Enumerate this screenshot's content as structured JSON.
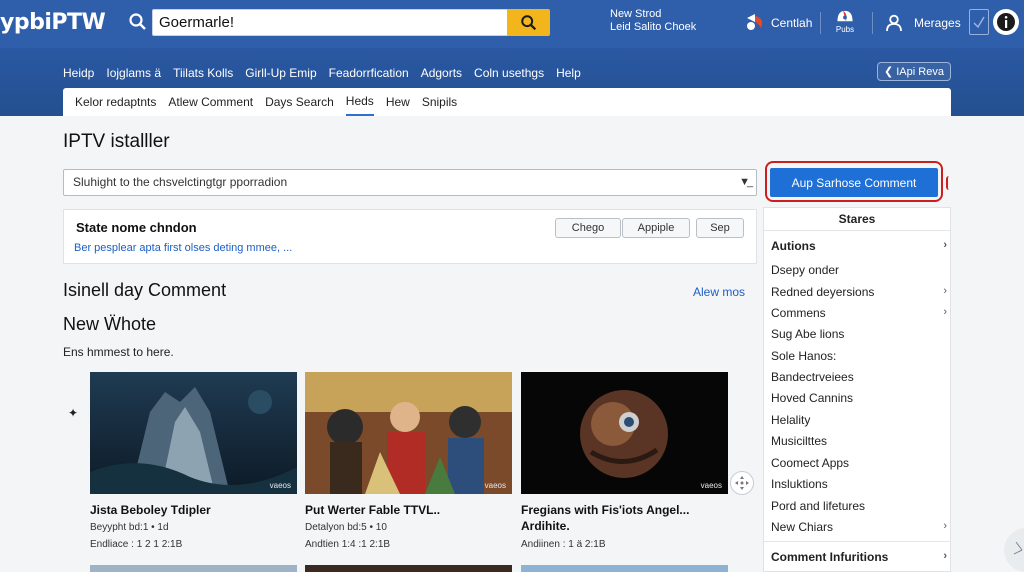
{
  "header": {
    "logo": "ypbiPTW",
    "search_value": "Goermarle!",
    "note_line1": "New Strod",
    "note_line2": "Leid Salito Choek",
    "item_centlah": "Centlah",
    "item_badge": "Pubs",
    "item_merages": "Merages"
  },
  "nav": {
    "items": [
      "Heidp",
      "Iojglams ä",
      "Tiilats Kolls",
      "Girll-Up Emip",
      "Feadorrfication",
      "Adgorts",
      "Coln usethgs",
      "Help"
    ],
    "version_button": "IApi Reva"
  },
  "subnav": {
    "items": [
      "Kelor redaptnts",
      "Atlew Comment",
      "Days Search",
      "Heds",
      "Hew",
      "Snipils"
    ],
    "active_index": 3
  },
  "page": {
    "title": "IPTV istalller",
    "filter_value": "Sluhight to the chsvelctingtgr pporradion",
    "primary_button": "Aup Sarhose Comment"
  },
  "state_card": {
    "title": "State nome chndon",
    "link": "Ber pesplear apta first olses deting mmee, ...",
    "buttons": [
      "Chego",
      "Appiple",
      "Sep"
    ]
  },
  "section": {
    "heading": "Isinell day Comment",
    "view_more": "Alew mos",
    "subheading": "New Ẅhote",
    "text": "Ens hmmest to here."
  },
  "videos": [
    {
      "title": "Jista Beboley Tdipler",
      "meta1": "Beyypht bd:1 • 1d",
      "meta2": "Endliace : 1 2 1 2:1B",
      "tag": "vaeos"
    },
    {
      "title": "Put Werter Fable TTVL..",
      "meta1": "Detalyon bd:5 • 10",
      "meta2": "Andtien 1:4 :1 2:1B",
      "tag": "vaeos"
    },
    {
      "title": "Fregians with Fis'iots Angel... Ardihite.",
      "meta1": "Andiinen : 1 ä 2:1B",
      "meta2": "",
      "tag": "vaeos"
    }
  ],
  "sidebar": {
    "heading": "Stares",
    "group_title": "Autions",
    "items": [
      {
        "label": "Dsepy onder",
        "chevron": false
      },
      {
        "label": "Redned deyersions",
        "chevron": true
      },
      {
        "label": "Commens",
        "chevron": true
      },
      {
        "label": "Sug Abe lions",
        "chevron": false
      },
      {
        "label": "Sole Hanos:",
        "chevron": false
      },
      {
        "label": "Bandectrveiees",
        "chevron": false
      },
      {
        "label": "Hoved Cannins",
        "chevron": false
      },
      {
        "label": "Helality",
        "chevron": false
      },
      {
        "label": "Musicilttes",
        "chevron": false
      },
      {
        "label": "Coomect Apps",
        "chevron": false
      },
      {
        "label": "Insluktions",
        "chevron": false
      },
      {
        "label": "Pord and lifetures",
        "chevron": false
      },
      {
        "label": "New Chiars",
        "chevron": true
      }
    ],
    "footer_title": "Comment Infuritions"
  },
  "colors": {
    "header_blue": "#2f5eab",
    "accent_yellow": "#f3b51c",
    "primary_blue": "#1e6fd6",
    "highlight_red": "#cc1e1e",
    "link_blue": "#1c5fc4"
  },
  "icons": [
    "search-icon",
    "share-icon",
    "camera-icon",
    "user-icon",
    "info-icon",
    "chevron-right-icon",
    "move-icon"
  ]
}
